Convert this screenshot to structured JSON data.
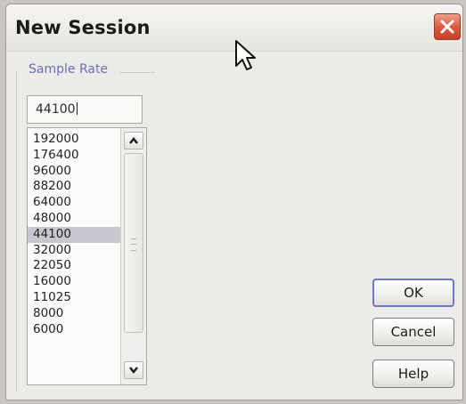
{
  "window": {
    "title": "New Session"
  },
  "sample_rate": {
    "group_label": "Sample Rate",
    "input_value": "44100",
    "options": [
      "192000",
      "176400",
      "96000",
      "88200",
      "64000",
      "48000",
      "44100",
      "32000",
      "22050",
      "16000",
      "11025",
      "8000",
      "6000"
    ],
    "selected": "44100"
  },
  "buttons": {
    "ok": "OK",
    "cancel": "Cancel",
    "help": "Help"
  },
  "icons": {
    "close": "close-icon",
    "scroll_up": "chevron-up-icon",
    "scroll_down": "chevron-down-icon",
    "cursor": "mouse-pointer-icon"
  },
  "colors": {
    "close_red": "#d9573b",
    "group_label": "#6a6fb8",
    "selection": "#c7c7cf"
  }
}
